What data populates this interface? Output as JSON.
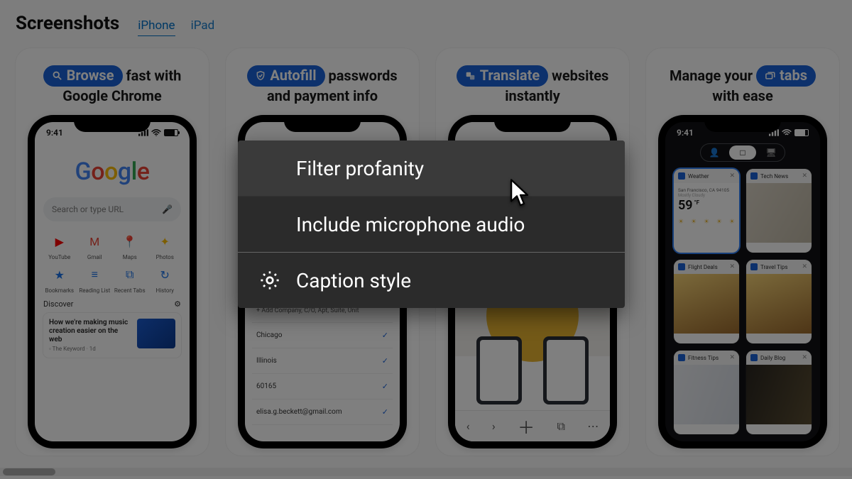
{
  "header": {
    "title": "Screenshots",
    "tabs": {
      "iphone": "iPhone",
      "ipad": "iPad"
    }
  },
  "cards": [
    {
      "pill_icon": "search",
      "pill_label": "Browse",
      "tail": " fast with Google Chrome"
    },
    {
      "pill_icon": "shield",
      "pill_label": "Autofill",
      "tail": " passwords and payment info"
    },
    {
      "pill_icon": "translate",
      "pill_label": "Translate",
      "tail": " websites instantly"
    },
    {
      "lead": "Manage your ",
      "pill_icon": "tabs",
      "pill_label": "tabs",
      "tail": " with ease"
    }
  ],
  "status_time": "9:41",
  "chrome_home": {
    "search_placeholder": "Search or type URL",
    "apps": [
      {
        "label": "YouTube",
        "icon": "▶",
        "color": "#ff0000"
      },
      {
        "label": "Gmail",
        "icon": "M",
        "color": "#ea4335"
      },
      {
        "label": "Maps",
        "icon": "📍",
        "color": "#34a853"
      },
      {
        "label": "Photos",
        "icon": "✦",
        "color": "#fbbc05"
      },
      {
        "label": "Bookmarks",
        "icon": "★",
        "color": "#1a73e8"
      },
      {
        "label": "Reading List",
        "icon": "≡",
        "color": "#1a73e8"
      },
      {
        "label": "Recent Tabs",
        "icon": "⧉",
        "color": "#1a73e8"
      },
      {
        "label": "History",
        "icon": "↻",
        "color": "#1a73e8"
      }
    ],
    "discover_label": "Discover",
    "article_title": "How we're making music creation easier on the web",
    "article_source": "The Keyword"
  },
  "autofill": {
    "add_line": "+ Add Company, C/O, Apt, Suite, Unit",
    "rows": [
      "Chicago",
      "Illinois",
      "60165",
      "elisa.g.beckett@gmail.com"
    ]
  },
  "translate_toolbar": [
    "‹",
    "›",
    "＋",
    "⧉",
    "⋯"
  ],
  "tabs_screen": {
    "segments": [
      "👤",
      "□",
      "🖥"
    ],
    "tiles": [
      {
        "title": "Weather",
        "city": "San Francisco, CA 94105",
        "temp": "59",
        "cond": "Mostly Cloudy"
      },
      {
        "title": "Tech News"
      },
      {
        "title": "Flight Deals"
      },
      {
        "title": "Travel Tips"
      },
      {
        "title": "Fitness Tips"
      },
      {
        "title": "Daily Blog"
      }
    ]
  },
  "context_menu": {
    "items": [
      {
        "label": "Filter profanity",
        "icon": null
      },
      {
        "label": "Include microphone audio",
        "icon": null
      },
      {
        "label": "Caption style",
        "icon": "gear"
      }
    ]
  }
}
